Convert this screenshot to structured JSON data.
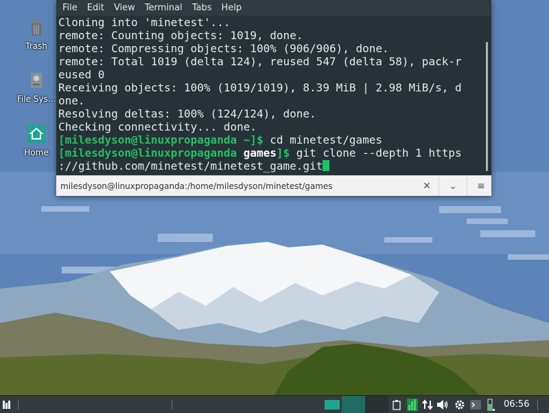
{
  "desktop": {
    "icons": [
      {
        "label": "Trash"
      },
      {
        "label": "File Sys..."
      },
      {
        "label": "Home"
      }
    ]
  },
  "terminal": {
    "menu": [
      "File",
      "Edit",
      "View",
      "Terminal",
      "Tabs",
      "Help"
    ],
    "lines": [
      "Cloning into 'minetest'...",
      "remote: Counting objects: 1019, done.",
      "remote: Compressing objects: 100% (906/906), done.",
      "remote: Total 1019 (delta 124), reused 547 (delta 58), pack-r",
      "eused 0",
      "Receiving objects: 100% (1019/1019), 8.39 MiB | 2.98 MiB/s, d",
      "one.",
      "Resolving deltas: 100% (124/124), done.",
      "Checking connectivity... done."
    ],
    "prompt1": {
      "user_host": "[milesdyson@linuxpropaganda",
      "dir": " ~",
      "end": "]$",
      "cmd": " cd minetest/games"
    },
    "prompt2": {
      "user_host": "[milesdyson@linuxpropaganda",
      "dir": " games",
      "end": "]$",
      "cmd": " git clone --depth 1 https"
    },
    "wrap_line": "://github.com/minetest/minetest_game.git",
    "tab_title": "milesdyson@linuxpropaganda:/home/milesdyson/minetest/games",
    "tab_close": "✕",
    "tab_down": "⌄",
    "tab_menu": "≡"
  },
  "taskbar": {
    "clock": "06:56",
    "icons": [
      "menu-icon",
      "workspace-1",
      "workspace-2",
      "workspace-3",
      "clipboard-icon",
      "network-monitor-icon",
      "transfer-icon",
      "volume-icon",
      "settings-icon",
      "terminal-icon",
      "battery-icon"
    ]
  },
  "colors": {
    "terminal_bg": "#263238",
    "prompt_green": "#25c062",
    "accent_teal": "#1e8c7e",
    "taskbar_bg": "#333b3f"
  }
}
